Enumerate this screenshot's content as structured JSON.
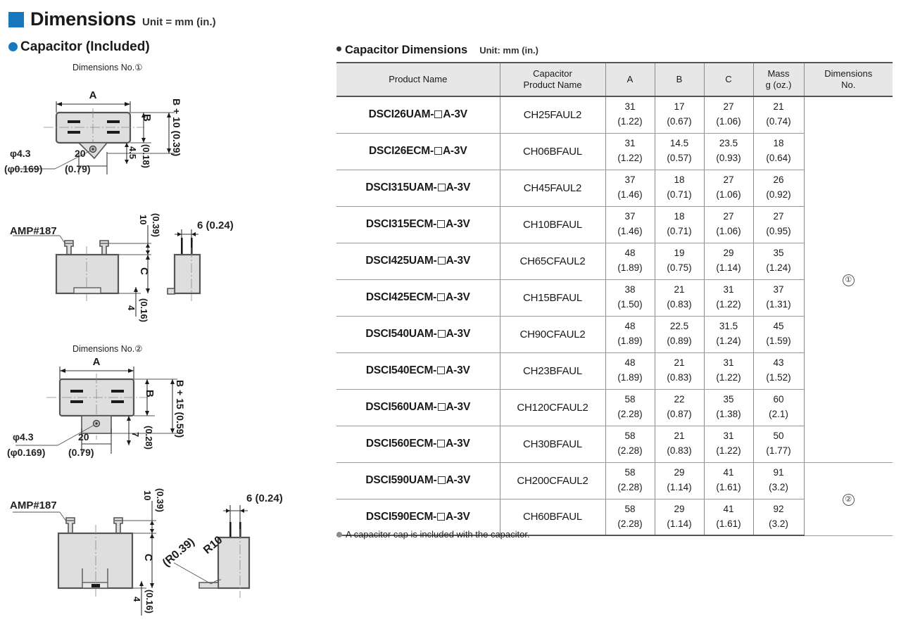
{
  "header": {
    "title": "Dimensions",
    "unit": "Unit = mm (in.)",
    "section": "Capacitor (Included)",
    "accent_color": "#1778be"
  },
  "drawings": {
    "caption_no1": "Dimensions No.①",
    "caption_no2": "Dimensions No.②",
    "labels": {
      "a": "A",
      "b": "B",
      "c": "C",
      "b_plus_10": "B + 10 (0.39)",
      "b_plus_15": "B + 15 (0.59)",
      "dia43": "φ4.3",
      "dia43_in": "(φ0.169)",
      "twenty": "20",
      "twenty_in": "(0.79)",
      "four_five": "4.5",
      "four_five_in": "(0.18)",
      "seven": "7",
      "seven_in": "(0.28)",
      "ten": "10",
      "ten_in": "(0.39)",
      "four": "4",
      "four_in": "(0.16)",
      "six": "6",
      "six_in": "(0.24)",
      "amp": "AMP#187",
      "r10": "R10",
      "r10_in": "(R0.39)"
    }
  },
  "table": {
    "title": "Capacitor Dimensions",
    "unit": "Unit: mm (in.)",
    "columns": [
      {
        "key": "product_name",
        "label": "Product Name"
      },
      {
        "key": "capacitor_product_name",
        "label": "Capacitor\nProduct Name"
      },
      {
        "key": "a",
        "label": "A"
      },
      {
        "key": "b",
        "label": "B"
      },
      {
        "key": "c",
        "label": "C"
      },
      {
        "key": "mass",
        "label": "Mass\ng (oz.)"
      },
      {
        "key": "dimensions_no",
        "label": "Dimensions\nNo."
      }
    ],
    "header": {
      "product_name": "Product Name",
      "capacitor_line1": "Capacitor",
      "capacitor_line2": "Product Name",
      "a": "A",
      "b": "B",
      "c": "C",
      "mass_line1": "Mass",
      "mass_line2": "g (oz.)",
      "dimno_line1": "Dimensions",
      "dimno_line2": "No."
    },
    "rows": [
      {
        "prefix": "DSCI26UAM-",
        "suffix": "A-3V",
        "cap": "CH25FAUL2",
        "a_mm": "31",
        "a_in": "(1.22)",
        "b_mm": "17",
        "b_in": "(0.67)",
        "c_mm": "27",
        "c_in": "(1.06)",
        "m_g": "21",
        "m_oz": "(0.74)"
      },
      {
        "prefix": "DSCI26ECM-",
        "suffix": "A-3V",
        "cap": "CH06BFAUL",
        "a_mm": "31",
        "a_in": "(1.22)",
        "b_mm": "14.5",
        "b_in": "(0.57)",
        "c_mm": "23.5",
        "c_in": "(0.93)",
        "m_g": "18",
        "m_oz": "(0.64)"
      },
      {
        "prefix": "DSCI315UAM-",
        "suffix": "A-3V",
        "cap": "CH45FAUL2",
        "a_mm": "37",
        "a_in": "(1.46)",
        "b_mm": "18",
        "b_in": "(0.71)",
        "c_mm": "27",
        "c_in": "(1.06)",
        "m_g": "26",
        "m_oz": "(0.92)"
      },
      {
        "prefix": "DSCI315ECM-",
        "suffix": "A-3V",
        "cap": "CH10BFAUL",
        "a_mm": "37",
        "a_in": "(1.46)",
        "b_mm": "18",
        "b_in": "(0.71)",
        "c_mm": "27",
        "c_in": "(1.06)",
        "m_g": "27",
        "m_oz": "(0.95)"
      },
      {
        "prefix": "DSCI425UAM-",
        "suffix": "A-3V",
        "cap": "CH65CFAUL2",
        "a_mm": "48",
        "a_in": "(1.89)",
        "b_mm": "19",
        "b_in": "(0.75)",
        "c_mm": "29",
        "c_in": "(1.14)",
        "m_g": "35",
        "m_oz": "(1.24)"
      },
      {
        "prefix": "DSCI425ECM-",
        "suffix": "A-3V",
        "cap": "CH15BFAUL",
        "a_mm": "38",
        "a_in": "(1.50)",
        "b_mm": "21",
        "b_in": "(0.83)",
        "c_mm": "31",
        "c_in": "(1.22)",
        "m_g": "37",
        "m_oz": "(1.31)"
      },
      {
        "prefix": "DSCI540UAM-",
        "suffix": "A-3V",
        "cap": "CH90CFAUL2",
        "a_mm": "48",
        "a_in": "(1.89)",
        "b_mm": "22.5",
        "b_in": "(0.89)",
        "c_mm": "31.5",
        "c_in": "(1.24)",
        "m_g": "45",
        "m_oz": "(1.59)"
      },
      {
        "prefix": "DSCI540ECM-",
        "suffix": "A-3V",
        "cap": "CH23BFAUL",
        "a_mm": "48",
        "a_in": "(1.89)",
        "b_mm": "21",
        "b_in": "(0.83)",
        "c_mm": "31",
        "c_in": "(1.22)",
        "m_g": "43",
        "m_oz": "(1.52)"
      },
      {
        "prefix": "DSCI560UAM-",
        "suffix": "A-3V",
        "cap": "CH120CFAUL2",
        "a_mm": "58",
        "a_in": "(2.28)",
        "b_mm": "22",
        "b_in": "(0.87)",
        "c_mm": "35",
        "c_in": "(1.38)",
        "m_g": "60",
        "m_oz": "(2.1)"
      },
      {
        "prefix": "DSCI560ECM-",
        "suffix": "A-3V",
        "cap": "CH30BFAUL",
        "a_mm": "58",
        "a_in": "(2.28)",
        "b_mm": "21",
        "b_in": "(0.83)",
        "c_mm": "31",
        "c_in": "(1.22)",
        "m_g": "50",
        "m_oz": "(1.77)"
      },
      {
        "prefix": "DSCI590UAM-",
        "suffix": "A-3V",
        "cap": "CH200CFAUL2",
        "a_mm": "58",
        "a_in": "(2.28)",
        "b_mm": "29",
        "b_in": "(1.14)",
        "c_mm": "41",
        "c_in": "(1.61)",
        "m_g": "91",
        "m_oz": "(3.2)"
      },
      {
        "prefix": "DSCI590ECM-",
        "suffix": "A-3V",
        "cap": "CH60BFAUL",
        "a_mm": "58",
        "a_in": "(2.28)",
        "b_mm": "29",
        "b_in": "(1.14)",
        "c_mm": "41",
        "c_in": "(1.61)",
        "m_g": "92",
        "m_oz": "(3.2)"
      }
    ],
    "dimensions_no_groups": [
      {
        "label": "①",
        "rows": 10
      },
      {
        "label": "②",
        "rows": 2
      }
    ],
    "footnote": "A capacitor cap is included with the capacitor."
  }
}
